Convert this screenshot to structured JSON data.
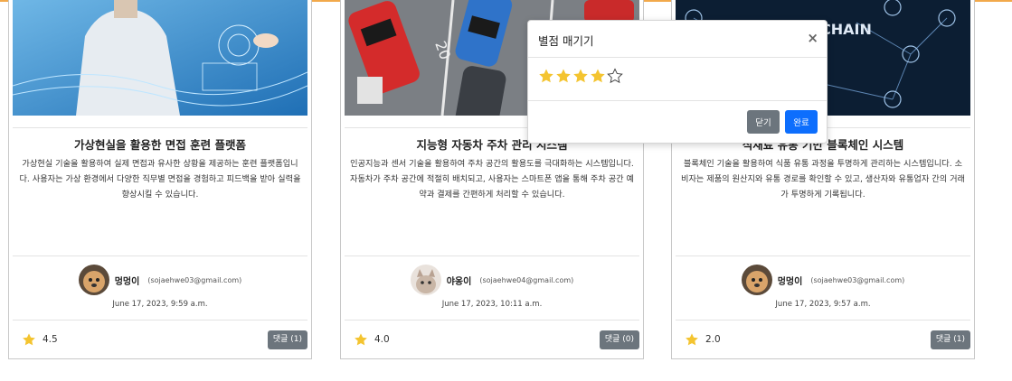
{
  "cards": [
    {
      "title": "가상현실을 활용한 면접 훈련 플랫폼",
      "description": "가상현실 기술을 활용하여 실제 면접과 유사한 상황을 제공하는 훈련 플랫폼입니다. 사용자는 가상 환경에서 다양한 직무별 면접을 경험하고 피드백을 받아 실력을 향상시킬 수 있습니다.",
      "author_name": "멍멍이",
      "author_email": "(sojaehwe03@gmail.com)",
      "date": "June 17, 2023, 9:59 a.m.",
      "rating": "4.5",
      "comments_label": "댓글 (1)",
      "image_icon": "vr-doctor-image"
    },
    {
      "title": "지능형 자동차 주차 관리 시스템",
      "description": "인공지능과 센서 기술을 활용하여 주차 공간의 활용도를 극대화하는 시스템입니다. 자동차가 주차 공간에 적절히 배치되고, 사용자는 스마트폰 앱을 통해 주차 공간 예약과 결제를 간편하게 처리할 수 있습니다.",
      "author_name": "야옹이",
      "author_email": "(sojaehwe04@gmail.com)",
      "date": "June 17, 2023, 10:11 a.m.",
      "rating": "4.0",
      "comments_label": "댓글 (0)",
      "image_icon": "parking-lot-image"
    },
    {
      "title": "식재료 유통 기반 블록체인 시스템",
      "description": "블록체인 기술을 활용하여 식품 유통 과정을 투명하게 관리하는 시스템입니다. 소비자는 제품의 원산지와 유통 경로를 확인할 수 있고, 생산자와 유통업자 간의 거래가 투명하게 기록됩니다.",
      "author_name": "멍멍이",
      "author_email": "(sojaehwe03@gmail.com)",
      "date": "June 17, 2023, 9:57 a.m.",
      "rating": "2.0",
      "comments_label": "댓글 (1)",
      "image_icon": "blockchain-image",
      "image_text": "CHAIN"
    }
  ],
  "modal": {
    "title": "별점 매기기",
    "close_symbol": "×",
    "stars_filled": 4,
    "stars_total": 5,
    "cancel_label": "닫기",
    "confirm_label": "완료"
  },
  "colors": {
    "accent_line": "#f2a94b",
    "star_gold": "#f4c430",
    "primary": "#0d6efd",
    "secondary": "#6c757d"
  }
}
